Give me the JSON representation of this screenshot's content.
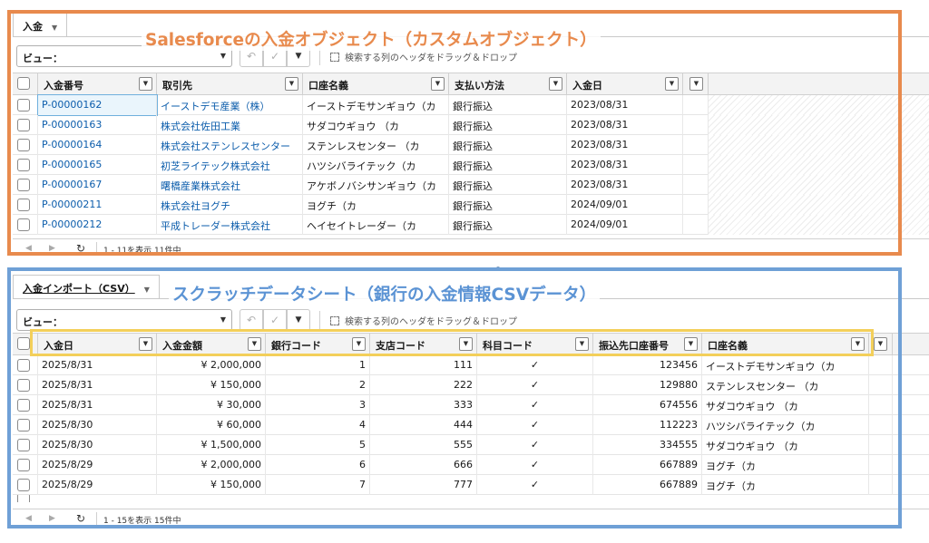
{
  "top": {
    "tab_label": "入金",
    "caption": "Salesforceの入金オブジェクト（カスタムオブジェクト）",
    "view_label": "ビュー：",
    "drag_hint": "検索する列のヘッダをドラッグ＆ドロップ",
    "columns": [
      "入金番号",
      "取引先",
      "口座名義",
      "支払い方法",
      "入金日"
    ],
    "rows": [
      [
        "P-00000162",
        "イーストデモ産業（株）",
        "イーストデモサンギョウ（カ",
        "銀行振込",
        "2023/08/31"
      ],
      [
        "P-00000163",
        "株式会社佐田工業",
        "サダコウギョウ （カ",
        "銀行振込",
        "2023/08/31"
      ],
      [
        "P-00000164",
        "株式会社ステンレスセンター",
        "ステンレスセンター （カ",
        "銀行振込",
        "2023/08/31"
      ],
      [
        "P-00000165",
        "初芝ライテック株式会社",
        "ハツシバライテック（カ",
        "銀行振込",
        "2023/08/31"
      ],
      [
        "P-00000167",
        "曙橋産業株式会社",
        "アケボノバシサンギョウ（カ",
        "銀行振込",
        "2023/08/31"
      ],
      [
        "P-00000211",
        "株式会社ヨグチ",
        "ヨグチ（カ",
        "銀行振込",
        "2024/09/01"
      ],
      [
        "P-00000212",
        "平成トレーダー株式会社",
        "ヘイセイトレーダー（カ",
        "銀行振込",
        "2024/09/01"
      ]
    ],
    "pager_info": "1 - 11を表示 11件中"
  },
  "bottom": {
    "tab_label": "入金インポート（CSV）",
    "caption": "スクラッチデータシート（銀行の入金情報CSVデータ）",
    "view_label": "ビュー：",
    "drag_hint": "検索する列のヘッダをドラッグ＆ドロップ",
    "columns": [
      "入金日",
      "入金金額",
      "銀行コード",
      "支店コード",
      "科目コード",
      "振込先口座番号",
      "口座名義"
    ],
    "rows": [
      [
        "2025/8/31",
        "¥ 2,000,000",
        "1",
        "111",
        "✓",
        "123456",
        "イーストデモサンギョウ（カ"
      ],
      [
        "2025/8/31",
        "¥ 150,000",
        "2",
        "222",
        "✓",
        "129880",
        "ステンレスセンター （カ"
      ],
      [
        "2025/8/31",
        "¥ 30,000",
        "3",
        "333",
        "✓",
        "674556",
        "サダコウギョウ （カ"
      ],
      [
        "2025/8/30",
        "¥ 60,000",
        "4",
        "444",
        "✓",
        "112223",
        "ハツシバライテック（カ"
      ],
      [
        "2025/8/30",
        "¥ 1,500,000",
        "5",
        "555",
        "✓",
        "334555",
        "サダコウギョウ （カ"
      ],
      [
        "2025/8/29",
        "¥ 2,000,000",
        "6",
        "666",
        "✓",
        "667889",
        "ヨグチ（カ"
      ],
      [
        "2025/8/29",
        "¥ 150,000",
        "7",
        "777",
        "✓",
        "667889",
        "ヨグチ（カ"
      ]
    ],
    "pager_info": "1 - 15を表示 15件中"
  },
  "colors": {
    "orange": "#e88a4d",
    "blue": "#6fa0d6",
    "yellow": "#f3cf5a",
    "link": "#0b5cab"
  },
  "icons": {
    "undo": "undo-icon",
    "check": "check-icon",
    "menu": "menu-icon",
    "refresh": "refresh-icon",
    "filter": "filter-dropdown-icon"
  }
}
